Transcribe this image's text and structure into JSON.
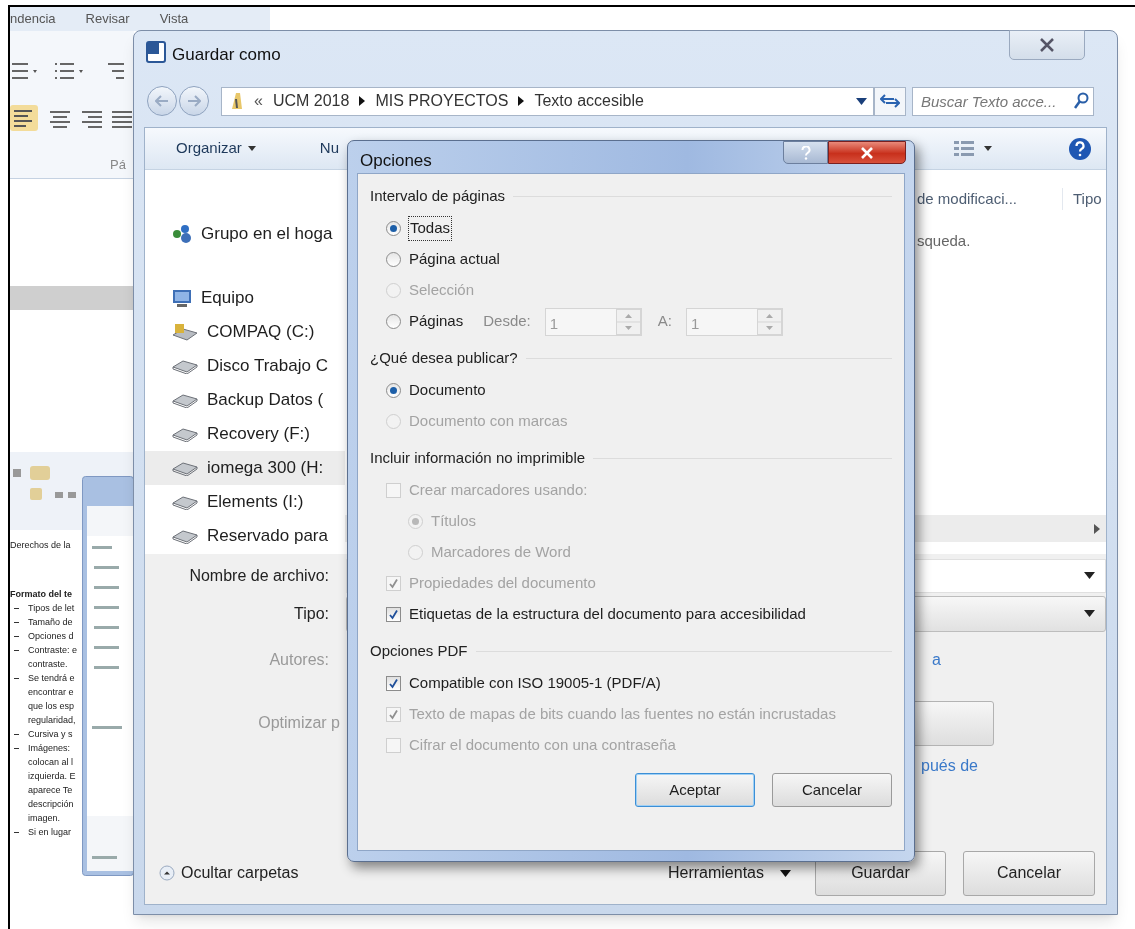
{
  "word": {
    "ribbon_tabs": [
      "ndencia",
      "Revisar",
      "Vista"
    ],
    "group_label": "Pá",
    "document_lines": [
      {
        "kind": "plain",
        "text": "Derechos de la"
      },
      {
        "kind": "heading",
        "text": "Formato del te"
      },
      {
        "kind": "bullet",
        "text": "Tipos de let"
      },
      {
        "kind": "bullet",
        "text": "Tamaño de"
      },
      {
        "kind": "bullet",
        "text": "Opciones d"
      },
      {
        "kind": "bullet",
        "text": "Contraste: e"
      },
      {
        "kind": "continued",
        "text": "contraste."
      },
      {
        "kind": "bullet",
        "text": "Se tendrá e"
      },
      {
        "kind": "continued",
        "text": "encontrar e"
      },
      {
        "kind": "continued",
        "text": "que los esp"
      },
      {
        "kind": "continued",
        "text": "regularidad,"
      },
      {
        "kind": "bullet",
        "text": "Cursiva y s"
      },
      {
        "kind": "bullet",
        "text": "Imágenes:"
      },
      {
        "kind": "continued",
        "text": "colocan al l"
      },
      {
        "kind": "continued",
        "text": "izquierda. E"
      },
      {
        "kind": "continued",
        "text": "aparece Te"
      },
      {
        "kind": "continued",
        "text": "descripción"
      },
      {
        "kind": "continued",
        "text": "imagen."
      },
      {
        "kind": "bullet",
        "text": "Si en lugar"
      }
    ]
  },
  "save_dialog": {
    "title": "Guardar como",
    "breadcrumb": {
      "overflow": "«",
      "parts": [
        "UCM 2018",
        "MIS PROYECTOS",
        "Texto accesible"
      ]
    },
    "search": {
      "placeholder": "Buscar Texto acce..."
    },
    "toolbar": {
      "organize": "Organizar",
      "new_folder": "Nu"
    },
    "nav_items": [
      {
        "kind": "homegroup",
        "label": "Grupo en el hoga",
        "selected": false
      },
      {
        "kind": "computer",
        "label": "Equipo",
        "selected": false
      },
      {
        "kind": "system_drive",
        "label": "COMPAQ (C:)",
        "selected": false
      },
      {
        "kind": "drive",
        "label": "Disco Trabajo C",
        "selected": false
      },
      {
        "kind": "drive",
        "label": "Backup Datos (",
        "selected": false
      },
      {
        "kind": "drive",
        "label": "Recovery (F:)",
        "selected": false
      },
      {
        "kind": "drive",
        "label": "iomega 300 (H:",
        "selected": true
      },
      {
        "kind": "drive",
        "label": "Elements (I:)",
        "selected": false
      },
      {
        "kind": "drive",
        "label": "Reservado para",
        "selected": false
      }
    ],
    "columns": [
      "de modificaci...",
      "Tipo"
    ],
    "empty_message": "squeda.",
    "filename_label": "Nombre de archivo:",
    "type_label": "Tipo:",
    "authors_label": "Autores:",
    "authors_link": "a",
    "optimize_label": "Optimizar p",
    "after_link": "pués de",
    "hide_folders": "Ocultar carpetas",
    "tools": "Herramientas",
    "buttons": [
      "Guardar",
      "Cancelar"
    ]
  },
  "options_dialog": {
    "title": "Opciones",
    "sections": [
      {
        "title": "Intervalo de páginas",
        "items": [
          {
            "kind": "radio",
            "label": "Todas",
            "selected": true,
            "disabled": false,
            "focused": true
          },
          {
            "kind": "radio",
            "label": "Página actual",
            "selected": false,
            "disabled": false,
            "focused": false
          },
          {
            "kind": "radio",
            "label": "Selección",
            "selected": false,
            "disabled": true,
            "focused": false
          },
          {
            "kind": "range",
            "label": "Páginas",
            "selected": false,
            "disabled": false,
            "focused": false,
            "from_label": "Desde:",
            "from": "1",
            "to_label": "A:",
            "to": "1"
          }
        ]
      },
      {
        "title": "¿Qué desea publicar?",
        "items": [
          {
            "kind": "radio",
            "label": "Documento",
            "selected": true,
            "disabled": false,
            "focused": false
          },
          {
            "kind": "radio",
            "label": "Documento con marcas",
            "selected": false,
            "disabled": true,
            "focused": false
          }
        ]
      },
      {
        "title": "Incluir información no imprimible",
        "items": [
          {
            "kind": "checkbox",
            "label": "Crear marcadores usando:",
            "checked": false,
            "disabled": true,
            "focused": false,
            "children": [
              {
                "kind": "radio",
                "label": "Títulos",
                "selected": true,
                "disabled": true,
                "focused": false
              },
              {
                "kind": "radio",
                "label": "Marcadores de Word",
                "selected": false,
                "disabled": true,
                "focused": false
              }
            ]
          },
          {
            "kind": "checkbox",
            "label": "Propiedades del documento",
            "checked": true,
            "disabled": true,
            "focused": false
          },
          {
            "kind": "checkbox",
            "label": "Etiquetas de la estructura del documento para accesibilidad",
            "checked": true,
            "disabled": false,
            "focused": false
          }
        ]
      },
      {
        "title": "Opciones PDF",
        "items": [
          {
            "kind": "checkbox",
            "label": "Compatible con ISO 19005-1 (PDF/A)",
            "checked": true,
            "disabled": false,
            "focused": false
          },
          {
            "kind": "checkbox",
            "label": "Texto de mapas de bits cuando las fuentes no están incrustadas",
            "checked": true,
            "disabled": true,
            "focused": false
          },
          {
            "kind": "checkbox",
            "label": "Cifrar el documento con una contraseña",
            "checked": false,
            "disabled": true,
            "focused": false
          }
        ]
      }
    ],
    "buttons": [
      {
        "label": "Aceptar",
        "default": true
      },
      {
        "label": "Cancelar",
        "default": false
      }
    ]
  }
}
